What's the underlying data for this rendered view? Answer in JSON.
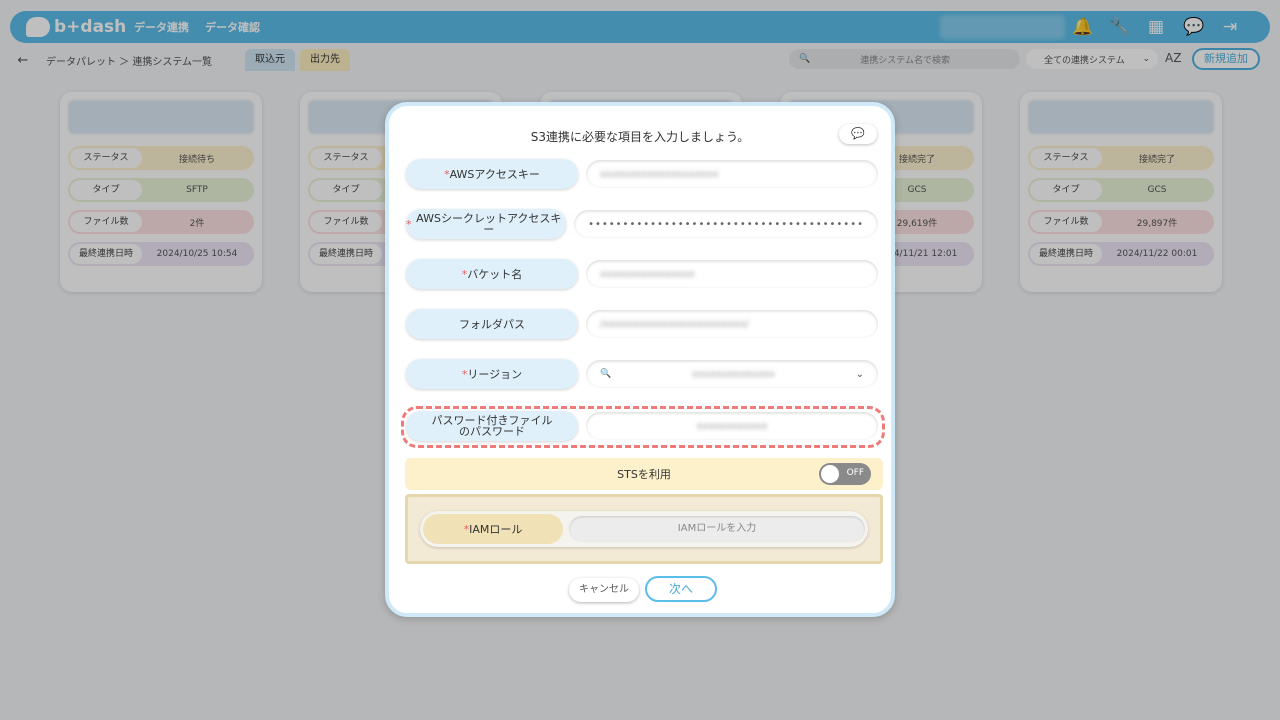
{
  "app": {
    "logo": "b+dash",
    "nav": [
      "データ連携",
      "データ確認"
    ]
  },
  "header_icons": [
    "bell-icon",
    "wrench-icon",
    "grid-icon",
    "chat-icon",
    "logout-icon"
  ],
  "subbar": {
    "back_icon": "←",
    "breadcrumb": "データパレット ＞ 連携システム一覧",
    "tab_in": "取込元",
    "tab_out": "出力先",
    "search_placeholder": "連携システム名で検索",
    "filter_value": "全ての連携システム",
    "sort_label": "AZ",
    "new_button": "新規追加"
  },
  "cards": [
    {
      "status": "接続待ち",
      "type": "SFTP",
      "files": "2件",
      "last": "2024/10/25 10:54"
    },
    {
      "status": "",
      "type": "",
      "files": "",
      "last": ""
    },
    {
      "status": "",
      "type": "",
      "files": "",
      "last": ""
    },
    {
      "status": "接続完了",
      "type": "GCS",
      "files": "29,619件",
      "last": "2024/11/21 12:01"
    },
    {
      "status": "接続完了",
      "type": "GCS",
      "files": "29,897件",
      "last": "2024/11/22 00:01"
    }
  ],
  "card_labels": {
    "status": "ステータス",
    "type": "タイプ",
    "files": "ファイル数",
    "last": "最終連携日時"
  },
  "modal": {
    "title": "S3連携に必要な項目を入力しましょう。",
    "fields": [
      {
        "required": true,
        "label": "AWSアクセスキー",
        "value": "xxxxxxxxxxxxxxxxxxxx"
      },
      {
        "required": true,
        "label": "AWSシークレットアクセスキー",
        "value": "••••••••••••••••••••••••••••••••••••••••"
      },
      {
        "required": true,
        "label": "バケット名",
        "value": "xxxxxxxxxxxxxxxx"
      },
      {
        "required": false,
        "label": "フォルダパス",
        "value": "/xxxxxxxxxxxxxxxxxxxxxxxx/"
      },
      {
        "required": true,
        "label": "リージョン",
        "value": "xxxxxxxxxxxxxx"
      },
      {
        "required": false,
        "label": "パスワード付きファイルのパスワード",
        "value": "xxxxxxxxxxxx"
      }
    ],
    "sts_label": "STSを利用",
    "sts_toggle": "OFF",
    "iam_label": "IAMロール",
    "iam_placeholder": "IAMロールを入力",
    "cancel": "キャンセル",
    "next": "次へ"
  }
}
